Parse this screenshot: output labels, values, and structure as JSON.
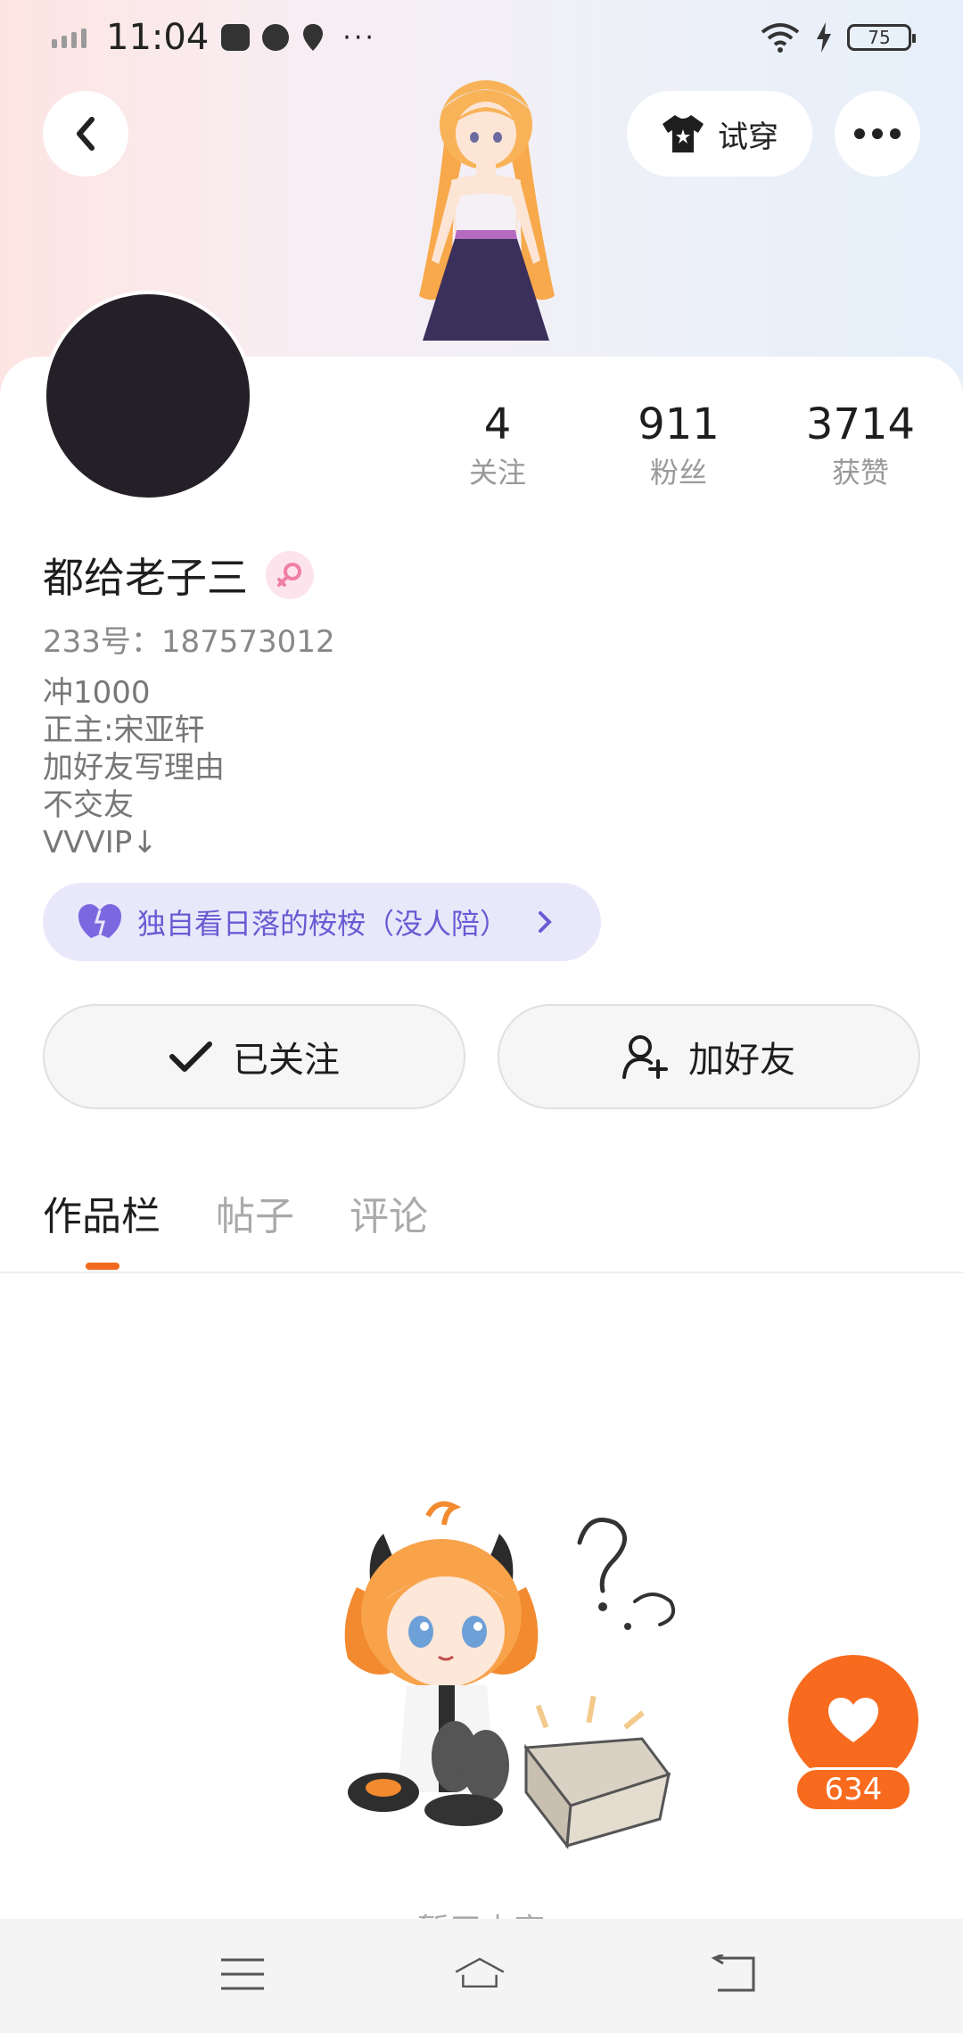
{
  "status_bar": {
    "time": "11:04",
    "battery": "75",
    "more": "···"
  },
  "header": {
    "try_on_label": "试穿",
    "accent_color": "#f86b1e"
  },
  "profile": {
    "stats": [
      {
        "value": "4",
        "label": "关注"
      },
      {
        "value": "911",
        "label": "粉丝"
      },
      {
        "value": "3714",
        "label": "获赞"
      }
    ],
    "username": "都给老子三",
    "uid": "233号：187573012",
    "bio_lines": [
      "冲1000",
      "正主:宋亚轩",
      "加好友写理由",
      "不交友",
      "VVVIP↓"
    ],
    "tag_text": "独自看日落的桉桉（没人陪）"
  },
  "actions": {
    "follow_label": "已关注",
    "add_friend_label": "加好友"
  },
  "tabs": [
    {
      "label": "作品栏",
      "active": true
    },
    {
      "label": "帖子",
      "active": false
    },
    {
      "label": "评论",
      "active": false
    }
  ],
  "empty_state": {
    "text": "暂无内容"
  },
  "like_fab": {
    "count": "634"
  },
  "icons": [
    "back-icon",
    "shirt-icon",
    "more-icon",
    "female-icon",
    "heart-icon",
    "check-icon",
    "add-user-icon",
    "menu-icon",
    "home-icon",
    "return-icon"
  ]
}
